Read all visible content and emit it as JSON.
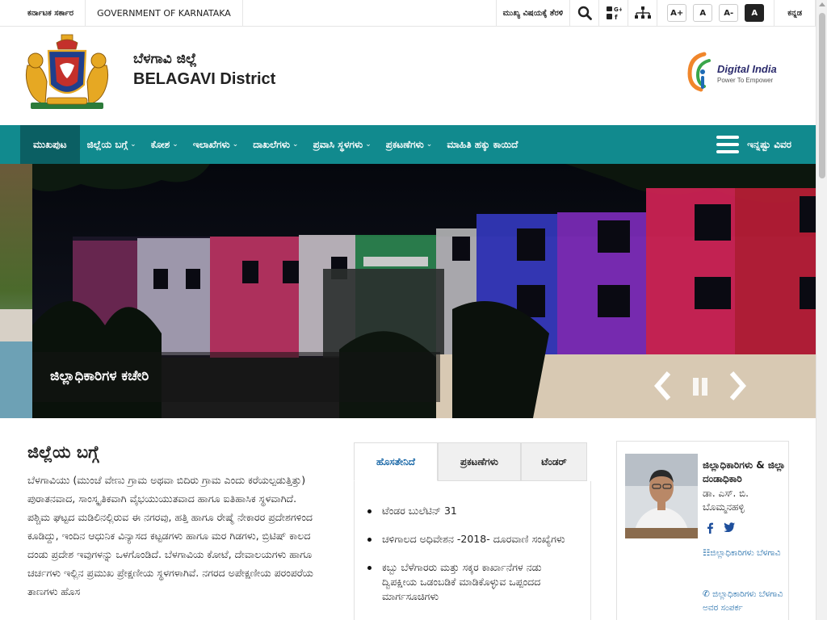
{
  "topbar": {
    "gov_kannada": "ಕರ್ನಾಟಕ ಸರ್ಕಾರ",
    "gov_english": "GOVERNMENT OF KARNATAKA",
    "skip_main": "ಮುಖ್ಯ ವಿಷಯಕ್ಕೆ ತೆರಳಿ",
    "font_increase": "A+",
    "font_normal": "A",
    "font_decrease": "A-",
    "contrast": "A",
    "language": "ಕನ್ನಡ"
  },
  "header": {
    "district_kannada": "ಬೆಳಗಾವಿ ಜಿಲ್ಲೆ",
    "district_english": "BELAGAVI District",
    "digital_india_title": "Digital India",
    "digital_india_tagline": "Power To Empower"
  },
  "nav": {
    "items": [
      {
        "label": "ಮುಖಪುಟ"
      },
      {
        "label": "ಜಿಲ್ಲೆಯ ಬಗ್ಗೆ"
      },
      {
        "label": "ಕೋಶ"
      },
      {
        "label": "ಇಲಾಖೆಗಳು"
      },
      {
        "label": "ದಾಖಲೆಗಳು"
      },
      {
        "label": "ಪ್ರವಾಸಿ ಸ್ಥಳಗಳು"
      },
      {
        "label": "ಪ್ರಕಟಣೆಗಳು"
      },
      {
        "label": "ಮಾಹಿತಿ ಹಕ್ಕು ಕಾಯಿದೆ"
      }
    ],
    "more_label": "ಇನ್ನಷ್ಟು ವಿವರ"
  },
  "slider": {
    "caption": "ಜಿಲ್ಲಾಧಿಕಾರಿಗಳ ಕಚೇರಿ"
  },
  "about": {
    "heading": "ಜಿಲ್ಲೆಯ ಬಗ್ಗೆ",
    "text": "ಬೆಳಗಾವಿಯು (ಮುಂಚೆ ವೇಣು ಗ್ರಾಮ ಅಥವಾ ಬಿದಿರು ಗ್ರಾಮ ಎಂದು ಕರೆಯಲ್ಪಡುತ್ತಿತ್ತು) ಪುರಾತನವಾದ, ಸಾಂಸ್ಕೃತಿಕವಾಗಿ ವೈಭಯುಯುತವಾದ ಹಾಗೂ ಐತಿಹಾಸಿಕ ಸ್ಥಳವಾಗಿದೆ. ಪಶ್ಚಿಮ ಘಟ್ಟದ ಮಡಿಲಿನಲ್ಲಿರುವ ಈ ನಗರವು, ಹತ್ತಿ ಹಾಗೂ ರೇಷ್ಮೆ ನೇಕಾರರ ಪ್ರದೇಶಗಳಿಂದ ಕೂಡಿದ್ದು, ಇಂದಿನ ಆಧುನಿಕ ವಿನ್ಯಾಸದ ಕಟ್ಟಡಗಳು ಹಾಗೂ ಮರ ಗಿಡಗಳು, ಬ್ರಿಟಿಷ್ ಕಾಲದ ದಂಡು ಪ್ರದೇಶ ಇವುಗಳನ್ನು ಒಳಗೊಂಡಿದೆ. ಬೆಳಗಾವಿಯ ಕೋಟೆ, ದೇವಾಲಯಗಳು ಹಾಗೂ ಚರ್ಚಗಳು ಇಲ್ಲಿನ ಪ್ರಮುಖ ಪ್ರೇಕ್ಷಣೀಯ ಸ್ಥಳಗಳಾಗಿವೆ. ನಗರದ ಅಪೇಕ್ಷಣೀಯ ಪರಂಪರೆಯ ತಾಣಗಳು ಹೊಸ"
  },
  "tabs": {
    "items": [
      {
        "label": "ಹೊಸತೇನಿದೆ"
      },
      {
        "label": "ಪ್ರಕಟಣೆಗಳು"
      },
      {
        "label": "ಟೆಂಡರ್"
      }
    ],
    "news": [
      "ಟೆಂಡರ ಬುಲೆಟಿನ್ 31",
      "ಚಳಿಗಾಲದ ಅಧಿವೇಶನ -2018- ದೂರವಾಣಿ ಸಂಖ್ಯೆಗಳು",
      "ಕಬ್ಬು ಬೆಳೆಗಾರರು ಮತ್ತು ಸಕ್ಕರ ಕಾರ್ಖಾನೆಗಳ ನಡು ದ್ವಿಪಕ್ಷೀಯ ಒಡಂಬಡಿಕೆ ಮಾಡಿಕೊಳ್ಳುವ ಒಪ್ಪಂದದ ಮಾರ್ಗಸೂಚಿಗಳು"
    ]
  },
  "dc": {
    "title": "ಜಿಲ್ಲಾಧಿಕಾರಿಗಳು & ಜಿಲ್ಲಾ ದಂಡಾಧಿಕಾರಿ",
    "name": "ಡಾ. ಎಸ್. ಬಿ. ಬೊಮ್ಮನಹಳ್ಳಿ",
    "link1": "ಜಿಲ್ಲಾಧಿಕಾರಿಗಳು ಬೆಳಗಾವಿ",
    "link2": "ಜಿಲ್ಲಾಧಿಕಾರಿಗಳು ಬೆಳಗಾವಿ ಅವರ ಸಂಪರ್ಕ"
  },
  "colors": {
    "nav_bg": "#118a8e",
    "nav_active": "#0b5f63",
    "tab_active_text": "#1464a5"
  },
  "icons": [
    "search-icon",
    "social-media-icon",
    "sitemap-icon",
    "menu-icon",
    "prev-arrow-icon",
    "next-arrow-icon",
    "pause-icon",
    "facebook-icon",
    "twitter-icon",
    "document-icon",
    "phone-icon"
  ]
}
